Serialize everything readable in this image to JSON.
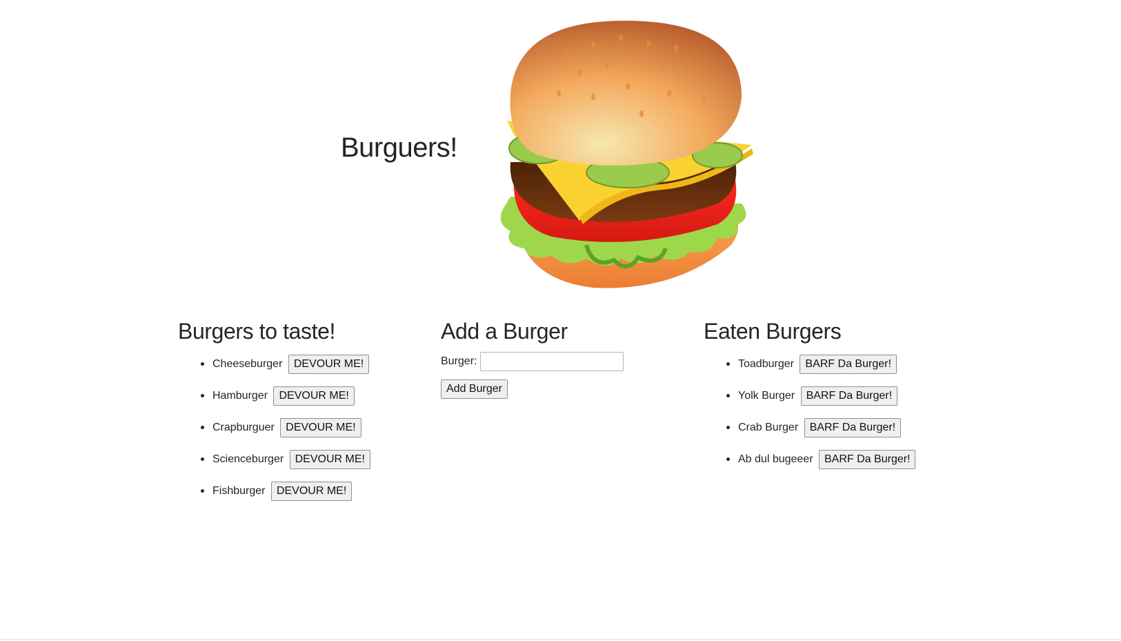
{
  "header": {
    "title": "Burguers!"
  },
  "to_taste": {
    "heading": "Burgers to taste!",
    "button_label": "DEVOUR ME!",
    "items": [
      "Cheeseburger",
      "Hamburger",
      "Crapburguer",
      "Scienceburger",
      "Fishburger"
    ]
  },
  "add_form": {
    "heading": "Add a Burger",
    "label": "Burger:",
    "value": "",
    "placeholder": "",
    "submit_label": "Add Burger"
  },
  "eaten": {
    "heading": "Eaten Burgers",
    "button_label": "BARF Da Burger!",
    "items": [
      "Toadburger",
      "Yolk Burger",
      "Crab Burger",
      "Ab dul bugeeer"
    ]
  }
}
